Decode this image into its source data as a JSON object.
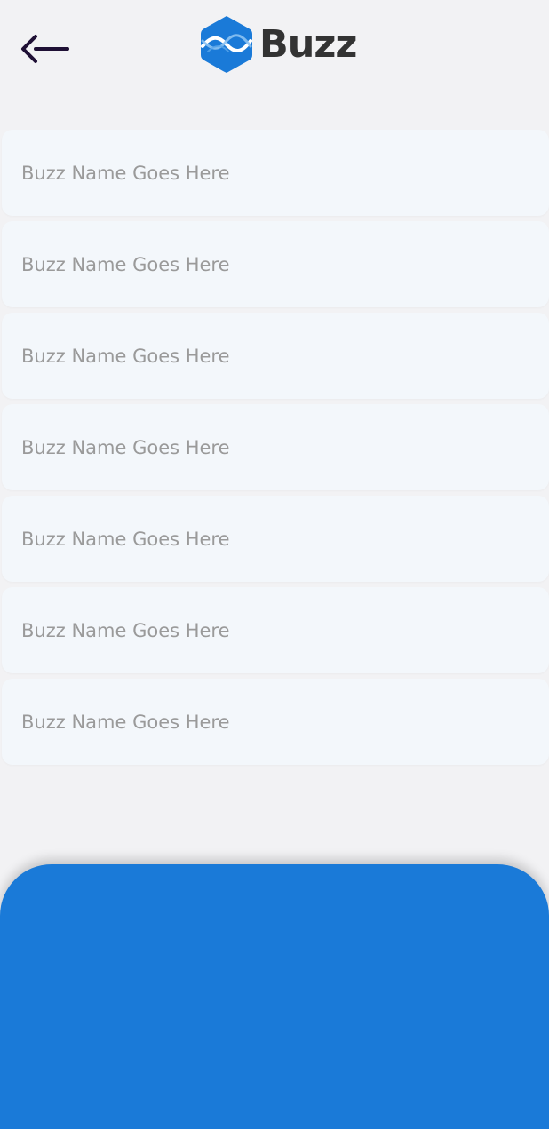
{
  "header": {
    "back_icon": "arrow-left-icon",
    "logo_icon": "buzz-hexagon-logo-icon",
    "logo_text": "Buzz"
  },
  "buzz_list": [
    {
      "label": "Buzz Name Goes Here"
    },
    {
      "label": "Buzz Name Goes Here"
    },
    {
      "label": "Buzz Name Goes Here"
    },
    {
      "label": "Buzz Name Goes Here"
    },
    {
      "label": "Buzz Name Goes Here"
    },
    {
      "label": "Buzz Name Goes Here"
    },
    {
      "label": "Buzz Name Goes Here"
    }
  ],
  "colors": {
    "background": "#f2f2f4",
    "list_item_bg": "#f3f7fb",
    "list_item_text": "#9a9a9a",
    "accent_blue": "#1a7ad8",
    "logo_text": "#333333",
    "back_arrow": "#1f1035"
  }
}
